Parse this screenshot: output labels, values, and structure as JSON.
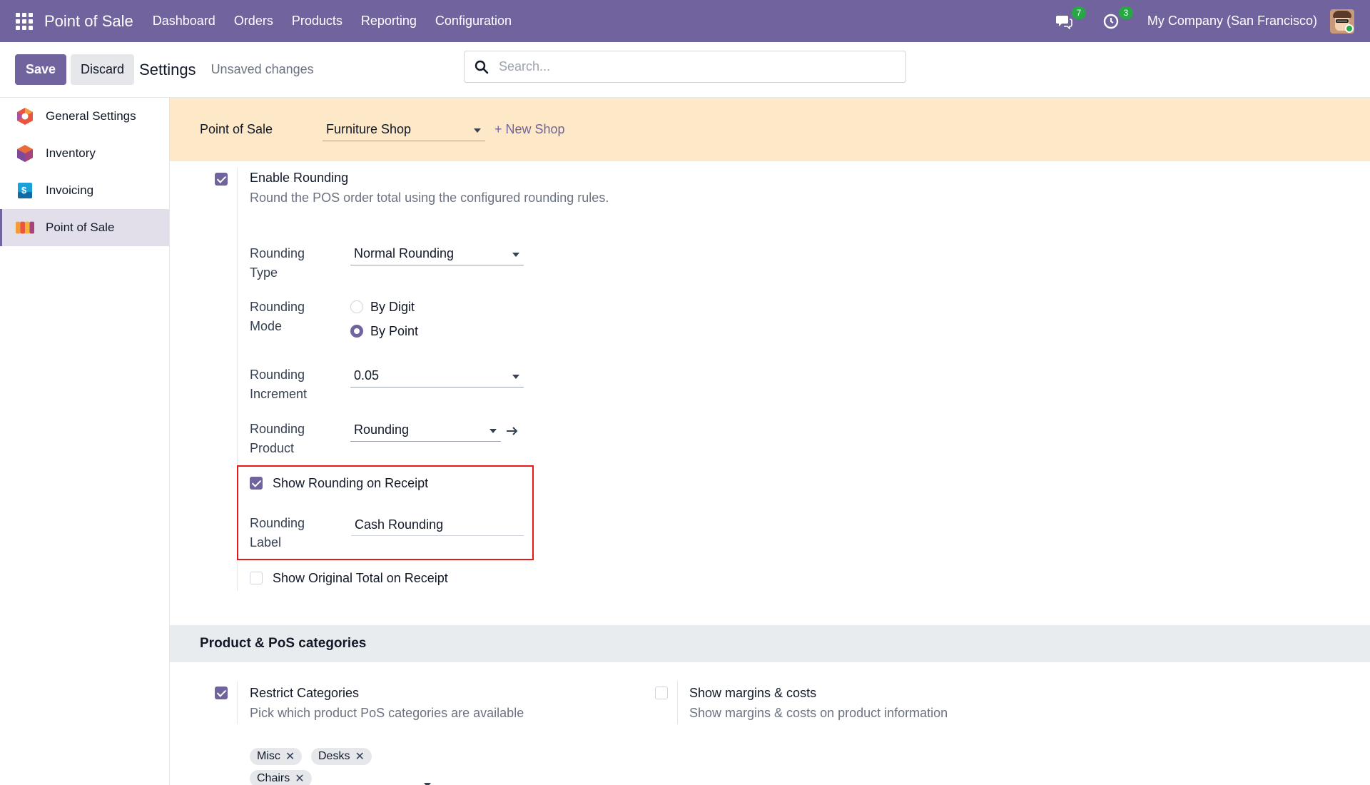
{
  "navbar": {
    "brand": "Point of Sale",
    "menu": [
      "Dashboard",
      "Orders",
      "Products",
      "Reporting",
      "Configuration"
    ],
    "messages_count": "7",
    "activities_count": "3",
    "company": "My Company (San Francisco)"
  },
  "control": {
    "save_label": "Save",
    "discard_label": "Discard",
    "title": "Settings",
    "status": "Unsaved changes",
    "search_placeholder": "Search..."
  },
  "sidebar": {
    "items": [
      {
        "label": "General Settings",
        "icon": "odoo-settings-icon"
      },
      {
        "label": "Inventory",
        "icon": "inventory-icon"
      },
      {
        "label": "Invoicing",
        "icon": "invoicing-icon"
      },
      {
        "label": "Point of Sale",
        "icon": "point-of-sale-icon"
      }
    ]
  },
  "shop_bar": {
    "label": "Point of Sale",
    "selected_shop": "Furniture Shop",
    "new_shop": "+ New Shop"
  },
  "rounding": {
    "enable_title": "Enable Rounding",
    "enable_desc": "Round the POS order total using the configured rounding rules.",
    "type_label": "Rounding Type",
    "type_value": "Normal Rounding",
    "mode_label": "Rounding Mode",
    "mode_options": [
      "By Digit",
      "By Point"
    ],
    "increment_label": "Rounding Increment",
    "increment_value": "0.05",
    "product_label": "Rounding Product",
    "product_value": "Rounding",
    "show_on_receipt": "Show Rounding on Receipt",
    "label_label": "Rounding Label",
    "label_value": "Cash Rounding",
    "show_original_total": "Show Original Total on Receipt"
  },
  "categories_section": {
    "title": "Product & PoS categories",
    "restrict_title": "Restrict Categories",
    "restrict_desc": "Pick which product PoS categories are available",
    "margins_title": "Show margins & costs",
    "margins_desc": "Show margins & costs on product information",
    "tags": [
      "Misc",
      "Desks",
      "Chairs"
    ]
  },
  "colors": {
    "brand": "#71639e",
    "banner": "#fde9c8",
    "highlight": "#e21a1a"
  }
}
